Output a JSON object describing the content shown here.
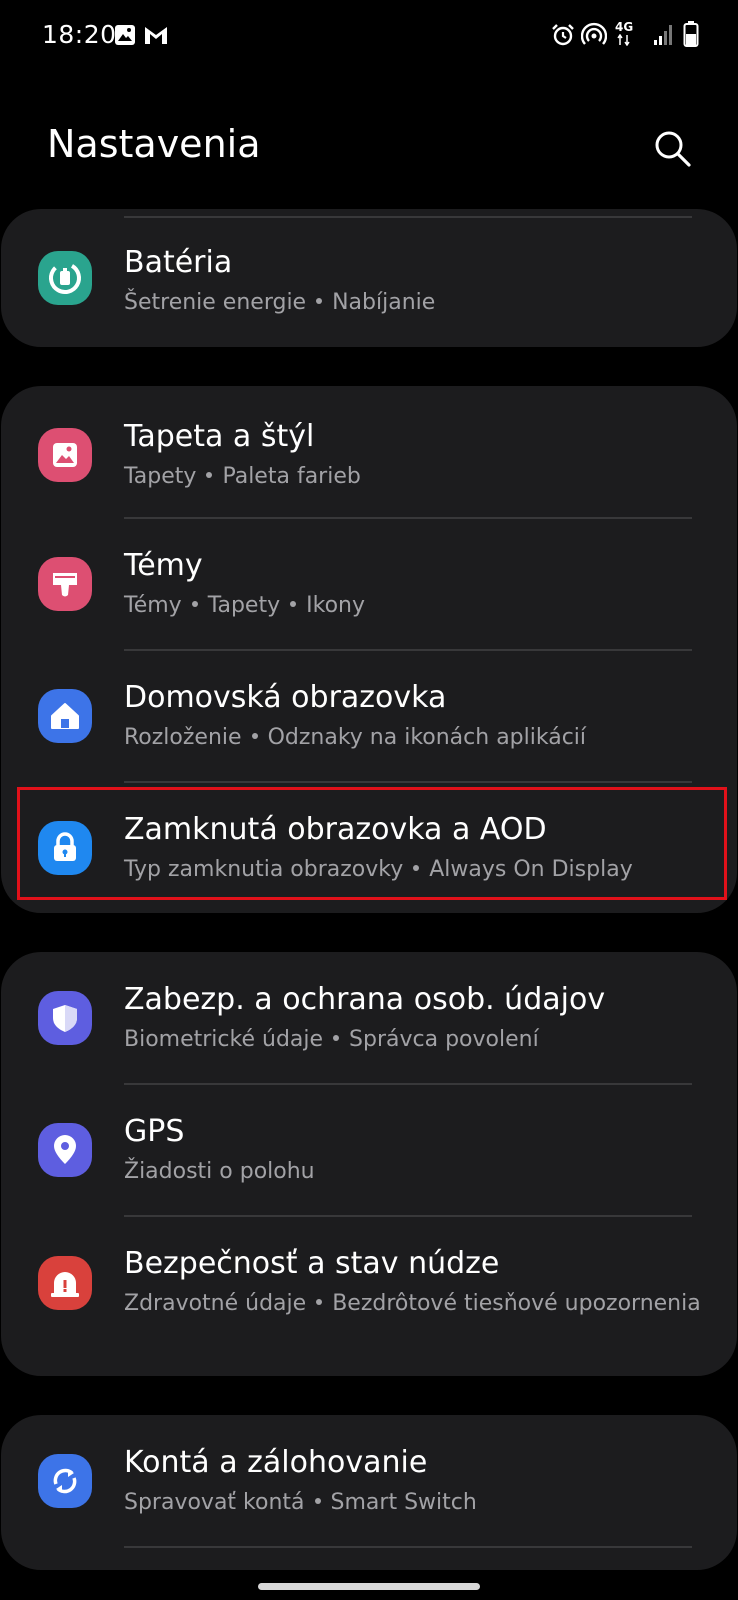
{
  "status_bar": {
    "time": "18:20",
    "network": "4G",
    "left_icons": [
      "gallery-icon",
      "gmail-icon"
    ],
    "right_icons": [
      "alarm-icon",
      "hotspot-icon",
      "4g-data-icon",
      "signal-icon",
      "battery-icon"
    ]
  },
  "header": {
    "title": "Nastavenia",
    "search_icon": "search-icon"
  },
  "colors": {
    "background": "#000000",
    "card": "#1c1c1e",
    "subtitle": "#a2a2a6",
    "highlight": "#e1111a"
  },
  "groups": [
    {
      "items": [
        {
          "title": "Batéria",
          "subtitle": [
            "Šetrenie energie",
            "Nabíjanie"
          ],
          "icon": "battery-care-icon",
          "icon_color": "#2aa48e"
        }
      ]
    },
    {
      "items": [
        {
          "title": "Tapeta a štýl",
          "subtitle": [
            "Tapety",
            "Paleta farieb"
          ],
          "icon": "wallpaper-icon",
          "icon_color": "#dd4f72"
        },
        {
          "title": "Témy",
          "subtitle": [
            "Témy",
            "Tapety",
            "Ikony"
          ],
          "icon": "themes-icon",
          "icon_color": "#dd4f72"
        },
        {
          "title": "Domovská obrazovka",
          "subtitle": [
            "Rozloženie",
            "Odznaky na ikonách aplikácií"
          ],
          "icon": "home-icon",
          "icon_color": "#3d74e8"
        },
        {
          "title": "Zamknutá obrazovka a AOD",
          "subtitle": [
            "Typ zamknutia obrazovky",
            "Always On Display"
          ],
          "icon": "lock-icon",
          "icon_color": "#1f88f0",
          "highlighted": true
        }
      ]
    },
    {
      "items": [
        {
          "title": "Zabezp. a ochrana osob. údajov",
          "subtitle": [
            "Biometrické údaje",
            "Správca povolení"
          ],
          "icon": "shield-icon",
          "icon_color": "#5e5ee0"
        },
        {
          "title": "GPS",
          "subtitle": [
            "Žiadosti o polohu"
          ],
          "icon": "location-icon",
          "icon_color": "#5e5ee0"
        },
        {
          "title": "Bezpečnosť a stav núdze",
          "subtitle": [
            "Zdravotné údaje",
            "Bezdrôtové tiesňové upozornenia"
          ],
          "icon": "emergency-icon",
          "icon_color": "#d9413c"
        }
      ]
    },
    {
      "items": [
        {
          "title": "Kontá a zálohovanie",
          "subtitle": [
            "Spravovať kontá",
            "Smart Switch"
          ],
          "icon": "sync-icon",
          "icon_color": "#3d74e8"
        }
      ]
    }
  ]
}
